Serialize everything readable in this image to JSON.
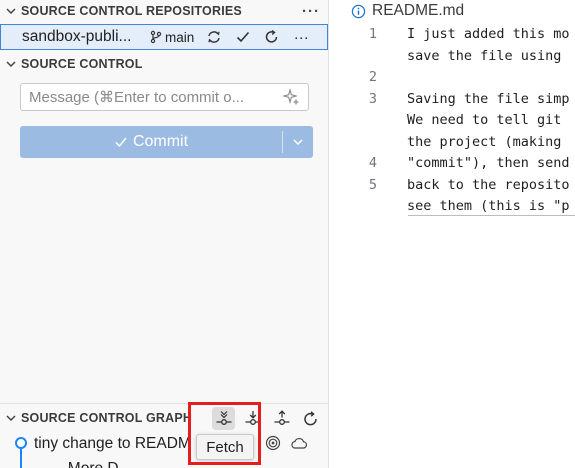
{
  "sidebar": {
    "repositories_title": "SOURCE CONTROL REPOSITORIES",
    "more_glyph": "···",
    "repo": {
      "name": "sandbox-publi...",
      "branch": "main"
    },
    "source_control_title": "SOURCE CONTROL",
    "message_input": {
      "value": "",
      "placeholder": "Message (⌘Enter to commit o..."
    },
    "commit_label": "Commit",
    "graph": {
      "title": "SOURCE CONTROL GRAPH",
      "commits": [
        {
          "message": "tiny change to READM"
        },
        {
          "message": "— More D..."
        }
      ],
      "tooltip": "Fetch"
    }
  },
  "editor": {
    "tab_title": "README.md",
    "lines": [
      {
        "number": "1",
        "text": "I just added this mo"
      },
      {
        "number": "",
        "text": "save the file using"
      },
      {
        "number": "2",
        "text": ""
      },
      {
        "number": "3",
        "text": "Saving the file simp"
      },
      {
        "number": "",
        "text": "We need to tell git"
      },
      {
        "number": "",
        "text": "the project (making"
      },
      {
        "number": "4",
        "text": "\"commit\"), then send"
      },
      {
        "number": "5",
        "text": "back to the reposito"
      },
      {
        "number": "",
        "text": "see them (this is \"p"
      }
    ]
  },
  "colors": {
    "accent": "#3f86d6",
    "commit_button": "#9bbbe3",
    "graph_line": "#1a85ff",
    "highlight": "#e41d1d"
  },
  "icons": [
    "chevron-down-icon",
    "branch-icon",
    "sync-icon",
    "check-icon",
    "refresh-icon",
    "sparkle-icon",
    "fetch-icon",
    "pull-icon",
    "push-icon",
    "target-icon",
    "cloud-icon",
    "info-icon"
  ]
}
